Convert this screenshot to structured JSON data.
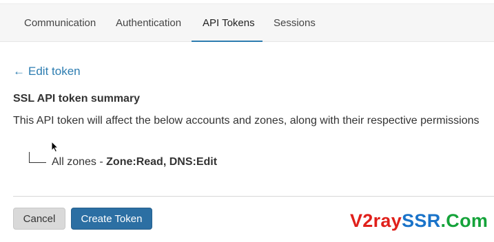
{
  "tabs": [
    {
      "label": "Communication"
    },
    {
      "label": "Authentication"
    },
    {
      "label": "API Tokens",
      "active": true
    },
    {
      "label": "Sessions"
    }
  ],
  "back_link": {
    "arrow": "←",
    "label": "Edit token"
  },
  "summary": {
    "heading": "SSL API token summary",
    "description": "This API token will affect the below accounts and zones, along with their respective permissions",
    "scope_prefix": "All zones - ",
    "scope_permissions": "Zone:Read, DNS:Edit"
  },
  "actions": {
    "cancel_label": "Cancel",
    "create_label": "Create Token"
  },
  "watermark": {
    "part1": "V2ray",
    "part2": "SSR",
    "part3": ".Com"
  },
  "colors": {
    "accent": "#2c7cb0",
    "primary_button": "#2c6fa3",
    "watermark_red": "#e0201b",
    "watermark_blue": "#1a73c9",
    "watermark_green": "#15a33a"
  }
}
